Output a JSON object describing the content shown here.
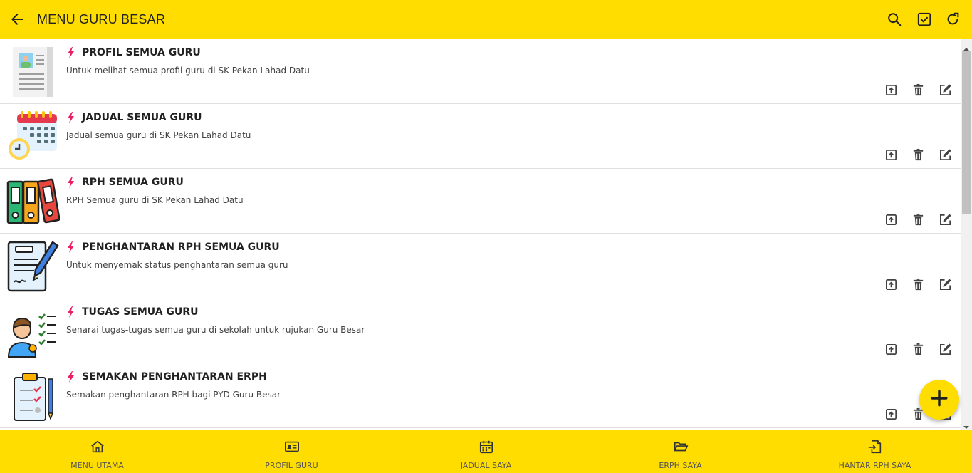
{
  "appbar": {
    "title": "MENU GURU BESAR",
    "back_icon": "arrow-left-icon",
    "actions": [
      "search-icon",
      "check-box-icon",
      "refresh-icon"
    ]
  },
  "accent_color": "#FFDD00",
  "bolt_color": "#E91E63",
  "items": [
    {
      "title": "PROFIL SEMUA GURU",
      "description": "Untuk melihat semua profil guru di SK Pekan Lahad Datu",
      "thumb": "profile-document-icon"
    },
    {
      "title": "JADUAL SEMUA GURU",
      "description": "Jadual semua guru di SK Pekan Lahad Datu",
      "thumb": "calendar-clock-icon"
    },
    {
      "title": "RPH SEMUA GURU",
      "description": "RPH Semua guru di SK Pekan Lahad Datu",
      "thumb": "binders-icon"
    },
    {
      "title": "PENGHANTARAN RPH SEMUA GURU",
      "description": "Untuk menyemak status penghantaran semua guru",
      "thumb": "contract-pen-icon"
    },
    {
      "title": "TUGAS SEMUA GURU",
      "description": "Senarai tugas-tugas semua guru di sekolah untuk rujukan Guru Besar",
      "thumb": "teacher-checklist-icon"
    },
    {
      "title": "SEMAKAN PENGHANTARAN ERPH",
      "description": "Semakan penghantaran RPH bagi PYD Guru Besar",
      "thumb": "clipboard-check-icon"
    }
  ],
  "row_actions": [
    "upload-icon",
    "delete-icon",
    "edit-icon"
  ],
  "fab_icon": "plus-icon",
  "bottom_nav": [
    {
      "label": "MENU UTAMA",
      "icon": "home-icon"
    },
    {
      "label": "PROFIL GURU",
      "icon": "id-card-icon"
    },
    {
      "label": "JADUAL SAYA",
      "icon": "calendar-icon"
    },
    {
      "label": "ERPH SAYA",
      "icon": "folder-open-icon"
    },
    {
      "label": "HANTAR RPH SAYA",
      "icon": "file-import-icon"
    }
  ]
}
